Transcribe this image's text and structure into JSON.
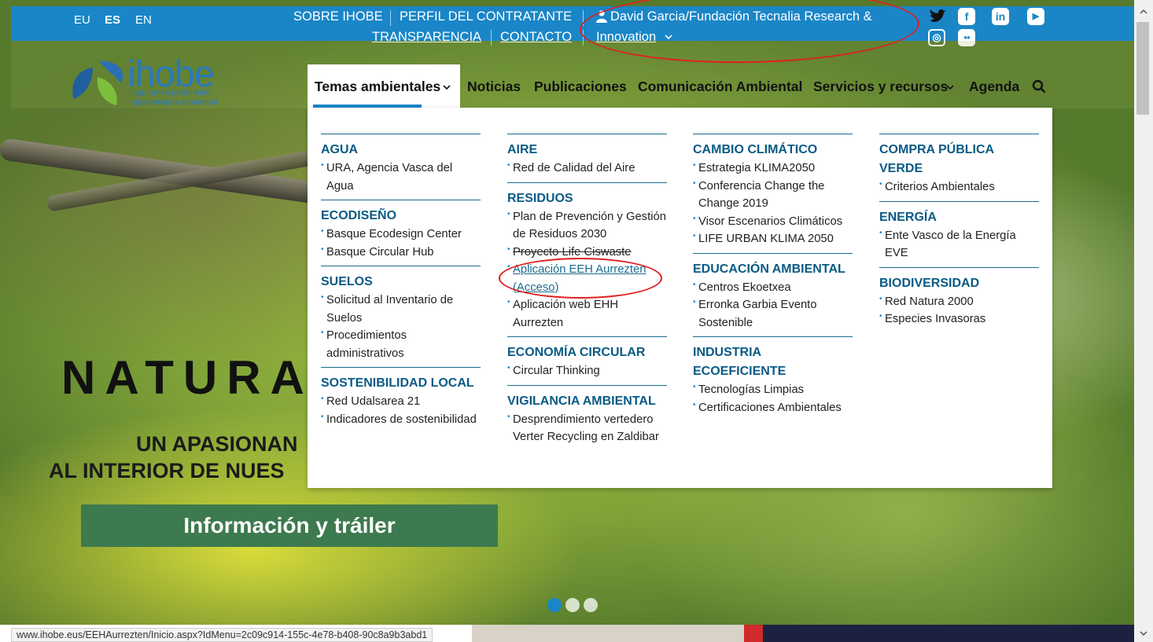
{
  "languages": [
    {
      "label": "EU",
      "active": false
    },
    {
      "label": "ES",
      "active": true
    },
    {
      "label": "EN",
      "active": false
    }
  ],
  "top_links": {
    "sobre": "SOBRE IHOBE",
    "perfil": "PERFIL DEL CONTRATANTE",
    "transparencia": "TRANSPARENCIA",
    "contacto": "CONTACTO",
    "user_line1": "David Garcia/Fundación Tecnalia Research &",
    "user_line2": "Innovation"
  },
  "social": {
    "twitter": "twitter-icon",
    "facebook": "f",
    "linkedin": "in",
    "youtube": "▶",
    "instagram": "◎",
    "flickr": "●●"
  },
  "logo": {
    "word": "ihobe",
    "tagline1": "ingurumen jardunbide egokien",
    "tagline2": "mejora ambiental"
  },
  "nav": {
    "temas": "Temas ambientales",
    "noticias": "Noticias",
    "publicaciones": "Publicaciones",
    "comunicacion": "Comunicación Ambiental",
    "servicios": "Servicios y recursos",
    "agenda": "Agenda"
  },
  "menu": {
    "col1": [
      {
        "title": "AGUA",
        "items": [
          "URA, Agencia Vasca del Agua"
        ]
      },
      {
        "title": "ECODISEÑO",
        "items": [
          "Basque Ecodesign Center",
          "Basque Circular Hub"
        ]
      },
      {
        "title": "SUELOS",
        "items": [
          "Solicitud al Inventario de Suelos",
          "Procedimientos administrativos"
        ]
      },
      {
        "title": "SOSTENIBILIDAD LOCAL",
        "items": [
          "Red Udalsarea 21",
          "Indicadores de sostenibilidad"
        ]
      }
    ],
    "col2": [
      {
        "title": "AIRE",
        "items": [
          "Red de Calidad del Aire"
        ]
      },
      {
        "title": "RESIDUOS",
        "items": [
          "Plan de Prevención y Gestión de Residuos 2030",
          "Proyecto Life Ciswaste",
          "Aplicación EEH Aurrezten (Acceso)",
          "Aplicación web EHH Aurrezten"
        ]
      },
      {
        "title": "ECONOMÍA CIRCULAR",
        "items": [
          "Circular Thinking"
        ]
      },
      {
        "title": "VIGILANCIA AMBIENTAL",
        "items": [
          "Desprendimiento vertedero Verter Recycling en Zaldibar"
        ]
      }
    ],
    "col3": [
      {
        "title": "CAMBIO CLIMÁTICO",
        "items": [
          "Estrategia KLIMA2050",
          "Conferencia Change the Change 2019",
          "Visor Escenarios Climáticos",
          "LIFE URBAN KLIMA 2050"
        ]
      },
      {
        "title": "EDUCACIÓN AMBIENTAL",
        "items": [
          "Centros Ekoetxea",
          "Erronka Garbia Evento Sostenible"
        ]
      },
      {
        "title": "INDUSTRIA ECOEFICIENTE",
        "items": [
          "Tecnologías Limpias",
          "Certificaciones Ambientales"
        ]
      }
    ],
    "col4": [
      {
        "title": "COMPRA PÚBLICA VERDE",
        "items": [
          "Criterios Ambientales"
        ]
      },
      {
        "title": "ENERGÍA",
        "items": [
          "Ente Vasco de la Energía EVE"
        ]
      },
      {
        "title": "BIODIVERSIDAD",
        "items": [
          "Red Natura 2000",
          "Especies Invasoras"
        ]
      }
    ]
  },
  "hero": {
    "title": "NATURA",
    "sub1": "UN APASIONAN",
    "sub2": "AL INTERIOR DE NUES",
    "cta": "Información y tráiler",
    "slides": 3,
    "active_slide": 1
  },
  "status_url": "www.ihobe.eus/EEHAurrezten/Inicio.aspx?IdMenu=2c09c914-155c-4e78-b408-90c8a9b3abd1",
  "colors": {
    "topbar": "#1a86c7",
    "menu_title": "#0a5a85",
    "cta": "#3d7a4f",
    "annotation": "#e02020"
  }
}
